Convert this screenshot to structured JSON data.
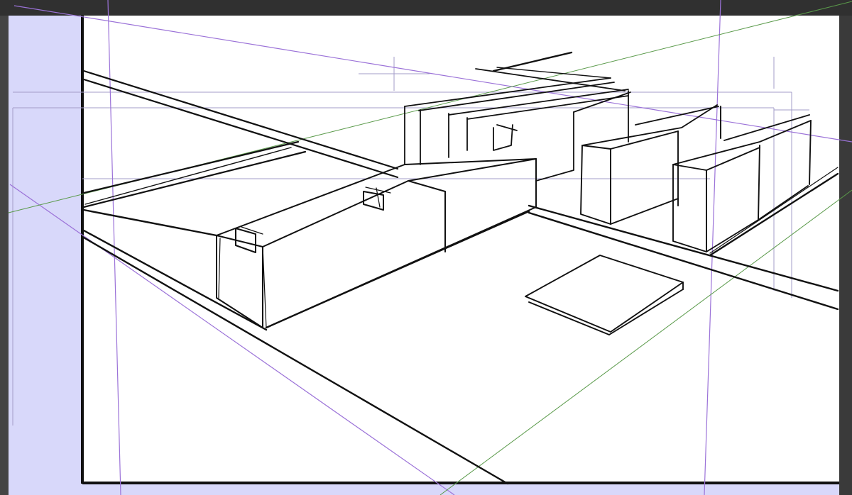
{
  "app": {
    "window_title": ""
  },
  "canvas": {
    "paper_color": "#ffffff",
    "overflow_tint": "#d8d8fa",
    "ink_color": "#111111",
    "perspective_ruler_color": "#9b72d8",
    "guide_color": "#a39cc8",
    "horizon_ruler_color": "#5a9a4a",
    "chrome_color": "#3a3a3a"
  },
  "drawing": {
    "subject": "city-block-perspective-sketch",
    "buildings_count": 7,
    "has_flat_slab": true
  }
}
